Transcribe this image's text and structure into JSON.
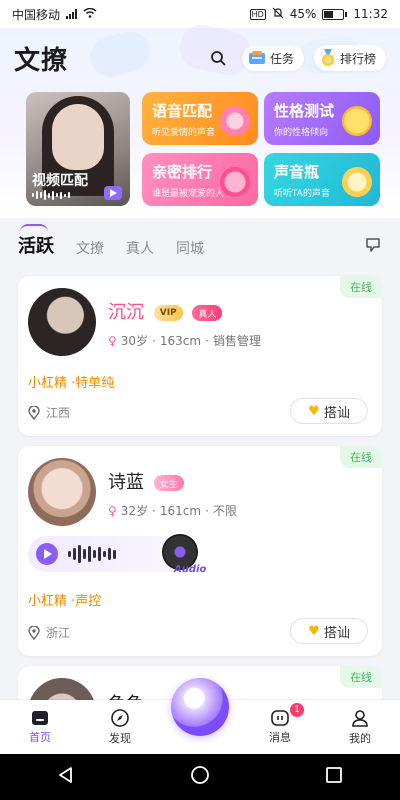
{
  "status_bar": {
    "carrier": "中国移动",
    "network": "4G",
    "hd": "HD",
    "battery": "45%",
    "battery_level": 0.45,
    "time": "11:32"
  },
  "header": {
    "title": "文撩",
    "tasks_label": "任务",
    "rank_label": "排行榜"
  },
  "banner": {
    "video": {
      "label": "视频匹配"
    },
    "features": [
      {
        "title": "语音匹配",
        "subtitle": "听见爱情的声音",
        "bg": "#ff9a2a"
      },
      {
        "title": "性格测试",
        "subtitle": "你的性格倾向",
        "bg": "#9b6bff"
      },
      {
        "title": "亲密排行",
        "subtitle": "谁是最被宠爱的人",
        "bg": "#ff78ad"
      },
      {
        "title": "声音瓶",
        "subtitle": "听听TA的声音",
        "bg": "#2fc8dc"
      }
    ]
  },
  "tabs": [
    {
      "label": "活跃",
      "active": true
    },
    {
      "label": "文撩",
      "active": false
    },
    {
      "label": "真人",
      "active": false
    },
    {
      "label": "同城",
      "active": false
    }
  ],
  "cards": [
    {
      "name": "沉沉",
      "online": "在线",
      "vip": "VIP",
      "real": "真人",
      "age": "30岁",
      "height": "163cm",
      "job": "销售管理",
      "tagline": "小杠精 ·特单纯",
      "location": "江西",
      "greet": "搭讪"
    },
    {
      "name": "诗蓝",
      "online": "在线",
      "gender_badge": "女生",
      "age": "32岁",
      "height": "161cm",
      "job": "不限",
      "voice_label": "Audio",
      "tagline": "小杠精 ·声控",
      "location": "浙江",
      "greet": "搭讪"
    },
    {
      "name": "鱼鱼",
      "online": "在线"
    }
  ],
  "bottom_nav": [
    {
      "label": "首页",
      "active": true
    },
    {
      "label": "发现",
      "active": false
    },
    {
      "label": "消息",
      "badge": "1",
      "active": false
    },
    {
      "label": "我的",
      "active": false
    }
  ],
  "colors": {
    "accent": "#7c4dff",
    "online": "#44b865",
    "tagline": "#f08c00",
    "name_highlight": "#ff4d87"
  }
}
